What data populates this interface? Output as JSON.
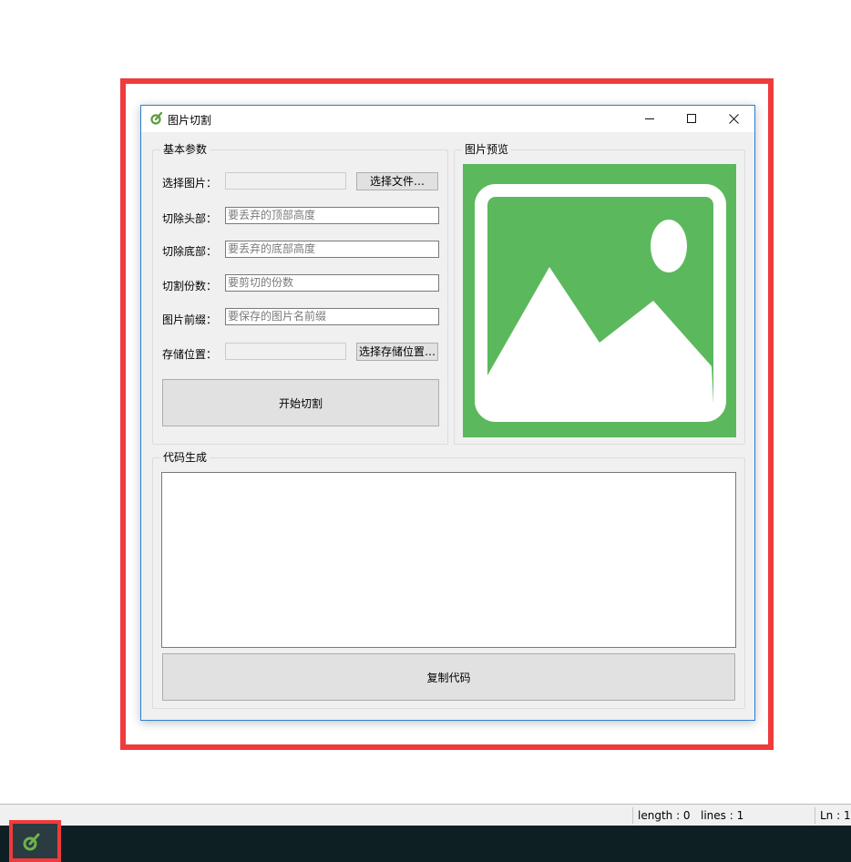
{
  "window": {
    "title": "图片切割",
    "minimize_glyph": "—",
    "maximize_glyph": "☐",
    "close_glyph": "✕"
  },
  "basic_params": {
    "legend": "基本参数",
    "select_image_label": "选择图片：",
    "select_image_value": "",
    "select_file_button": "选择文件…",
    "cut_top_label": "切除头部：",
    "cut_top_placeholder": "要丢弃的顶部高度",
    "cut_bottom_label": "切除底部：",
    "cut_bottom_placeholder": "要丢弃的底部高度",
    "parts_label": "切割份数：",
    "parts_placeholder": "要剪切的份数",
    "prefix_label": "图片前缀：",
    "prefix_placeholder": "要保存的图片名前缀",
    "save_location_label": "存储位置：",
    "save_location_value": "",
    "select_location_button": "选择存储位置…",
    "start_button": "开始切割"
  },
  "preview": {
    "legend": "图片预览",
    "icon": "image-placeholder-icon",
    "color": "#5cb85c"
  },
  "code_gen": {
    "legend": "代码生成",
    "code_text": "",
    "copy_button": "复制代码"
  },
  "statusbar": {
    "length": "length : 0",
    "lines": "lines : 1",
    "ln": "Ln : 1"
  },
  "taskbar": {
    "active_app_icon": "image-cutter-app-icon"
  },
  "colors": {
    "highlight": "#ef3b3b",
    "window_border": "#2b7fd4",
    "taskbar": "#0e1f24"
  }
}
